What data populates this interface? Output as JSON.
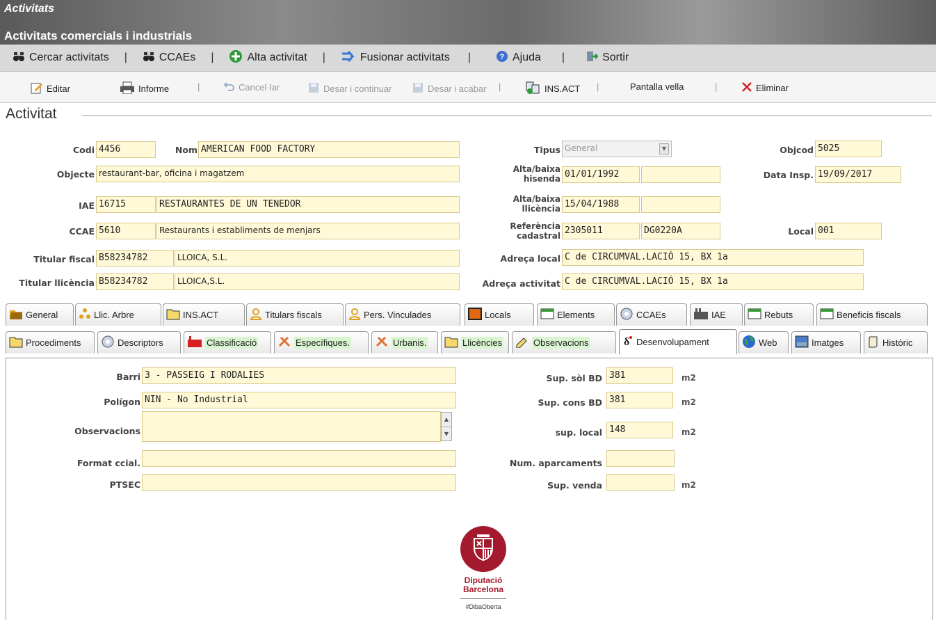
{
  "app": {
    "title": "Activitats",
    "subtitle": "Activitats comercials i industrials"
  },
  "menu": [
    {
      "label": "Cercar activitats",
      "icon": "binoculars-icon"
    },
    {
      "label": "CCAEs",
      "icon": "binoculars-icon"
    },
    {
      "label": "Alta activitat",
      "icon": "plus-circle-icon"
    },
    {
      "label": "Fusionar activitats",
      "icon": "merge-arrow-icon"
    },
    {
      "label": "Ajuda",
      "icon": "help-icon"
    },
    {
      "label": "Sortir",
      "icon": "exit-icon"
    }
  ],
  "toolbar": {
    "editar": "Editar",
    "informe": "Informe",
    "cancellar": "Cancel·lar",
    "desar_continuar": "Desar i continuar",
    "desar_acabar": "Desar i acabar",
    "insact": "INS.ACT",
    "pantalla_vella": "Pantalla vella",
    "eliminar": "Eliminar"
  },
  "section": {
    "title": "Activitat"
  },
  "form": {
    "codi_label": "Codi",
    "codi": "4456",
    "nom_label": "Nom",
    "nom": "AMERICAN FOOD FACTORY",
    "objecte_label": "Objecte",
    "objecte": "restaurant-bar, oficina i magatzem",
    "iae_label": "IAE",
    "iae_code": "16715",
    "iae_desc": "RESTAURANTES DE UN TENEDOR",
    "ccae_label": "CCAE",
    "ccae_code": "5610",
    "ccae_desc": "Restaurants i establiments de menjars",
    "titular_fiscal_label": "Titular fiscal",
    "titular_fiscal_nif": "B58234782",
    "titular_fiscal_nom": "LLOICA, S.L.",
    "titular_llicencia_label": "Titular llicència",
    "titular_llicencia_nif": "B58234782",
    "titular_llicencia_nom": "LLOICA,S.L.",
    "tipus_label": "Tipus",
    "tipus": "General",
    "objcod_label": "Objcod",
    "objcod": "5025",
    "alta_hisenda_label_1": "Alta/baixa",
    "alta_hisenda_label_2": "hisenda",
    "alta_hisenda": "01/01/1992",
    "baixa_hisenda": "",
    "data_insp_label": "Data Insp.",
    "data_insp": "19/09/2017",
    "alta_llicencia_label_1": "Alta/baixa",
    "alta_llicencia_label_2": "llicència",
    "alta_llicencia": "15/04/1988",
    "baixa_llicencia": "",
    "ref_cad_label_1": "Referència",
    "ref_cad_label_2": "cadastral",
    "ref_cad_1": "2305011",
    "ref_cad_2": "DG0220A",
    "local_label": "Local",
    "local": "001",
    "adreca_local_label": "Adreça local",
    "adreca_local": "C de CIRCUMVAL.LACIÓ 15, BX 1a",
    "adreca_activitat_label": "Adreça activitat",
    "adreca_activitat": "C de CIRCUMVAL.LACIÓ 15, BX 1a"
  },
  "tabs_row1": [
    "General",
    "Llic. Arbre",
    "INS.ACT",
    "Titulars fiscals",
    "Pers. Vinculades",
    "Locals",
    "Elements",
    "CCAEs",
    "IAE",
    "Rebuts",
    "Beneficis fiscals"
  ],
  "tabs_row2": [
    "Procediments",
    "Descriptors",
    "Classificació",
    "Específiques.",
    "Urbanis.",
    "Llicències",
    "Observacions",
    "Desenvolupament",
    "Web",
    "Imatges",
    "Històric"
  ],
  "desenvolupament": {
    "barri_label": "Barri",
    "barri": "3 - PASSEIG I RODALIES",
    "poligon_label": "Polígon",
    "poligon": "NIN - No Industrial",
    "observacions_label": "Observacions",
    "observacions": "",
    "format_label": "Format ccial.",
    "format": "",
    "ptsec_label": "PTSEC",
    "ptsec": "",
    "sup_sol_label": "Sup. sòl BD",
    "sup_sol": "381",
    "sup_cons_label": "Sup. cons BD",
    "sup_cons": "381",
    "sup_local_label": "sup. local",
    "sup_local": "148",
    "num_aparc_label": "Num. aparcaments",
    "num_aparc": "",
    "sup_venda_label": "Sup. venda",
    "sup_venda": "",
    "unit": "m2"
  },
  "logo": {
    "line1": "Diputació",
    "line2": "Barcelona",
    "tag": "#DibaOberta"
  },
  "colors": {
    "field_bg": "#fff9d7",
    "brand": "#a31a2e",
    "tab_green": "#d8f5d0"
  }
}
